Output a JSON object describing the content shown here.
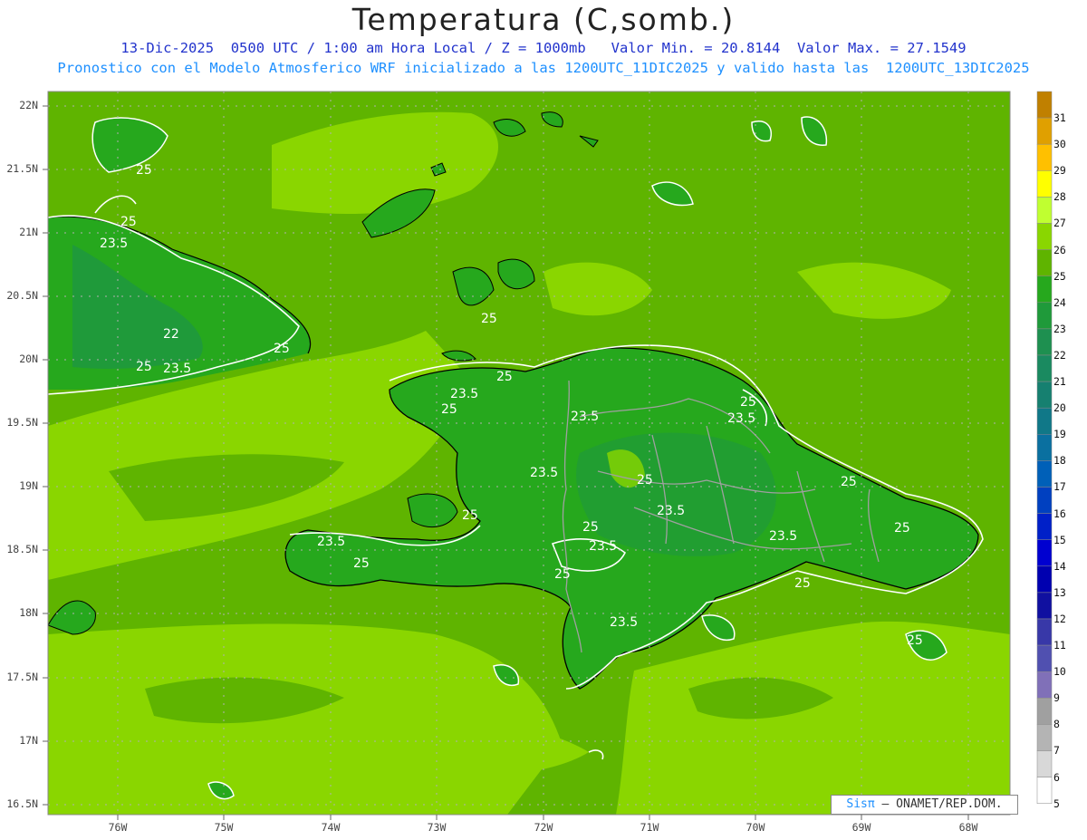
{
  "header": {
    "title": "Temperatura (C,somb.)",
    "subtitle1": "13-Dic-2025  0500 UTC / 1:00 am Hora Local / Z = 1000mb   Valor Min. = 20.8144  Valor Max. = 27.1549",
    "subtitle2": "Pronostico con el Modelo Atmosferico WRF inicializado a las 1200UTC_11DIC2025 y valido hasta las  1200UTC_13DIC2025"
  },
  "map": {
    "lat_labels": [
      "22N",
      "21.5N",
      "21N",
      "20.5N",
      "20N",
      "19.5N",
      "19N",
      "18.5N",
      "18N",
      "17.5N",
      "17N",
      "16.5N"
    ],
    "lon_labels": [
      "76W",
      "75W",
      "74W",
      "73W",
      "72W",
      "71W",
      "70W",
      "69W",
      "68W"
    ],
    "contour_labels": [
      "25",
      "25",
      "23.5",
      "22",
      "25",
      "23.5",
      "25",
      "25",
      "23.5",
      "25",
      "23.5",
      "25",
      "23.5",
      "25",
      "23.5",
      "25",
      "23.5",
      "25",
      "25",
      "23.5",
      "25",
      "23.5",
      "25",
      "23.5",
      "23.5",
      "25",
      "25",
      "25",
      "25"
    ],
    "credit_logo": "Sisπ",
    "credit_text": " – ONAMET/REP.DOM.",
    "colors": {
      "t25_26": "#8ad600",
      "t24_25": "#5fb400",
      "t23_24": "#26a81d",
      "t22_23": "#1f9a3a",
      "contour": "#ffffff",
      "coastline": "#000000",
      "borders": "#a0a0a0"
    }
  },
  "colorbar": {
    "labels": [
      "31",
      "30",
      "29",
      "28",
      "27",
      "26",
      "25",
      "24",
      "23",
      "22",
      "21",
      "20",
      "19",
      "18",
      "17",
      "16",
      "15",
      "14",
      "13",
      "12",
      "11",
      "10",
      "9",
      "8",
      "7",
      "6",
      "5"
    ],
    "colors": [
      "#c08000",
      "#e0a000",
      "#ffc000",
      "#ffff00",
      "#c0ff30",
      "#8ad600",
      "#5fb400",
      "#26a81d",
      "#1f9a3a",
      "#1e9050",
      "#1a8a60",
      "#168070",
      "#107888",
      "#0a70a0",
      "#0060b8",
      "#0040c0",
      "#0020c8",
      "#0000d0",
      "#0000b0",
      "#1010a0",
      "#3838a8",
      "#5050b0",
      "#8070b8",
      "#a0a0a0",
      "#b4b4b4",
      "#d8d8d8",
      "#ffffff"
    ]
  }
}
